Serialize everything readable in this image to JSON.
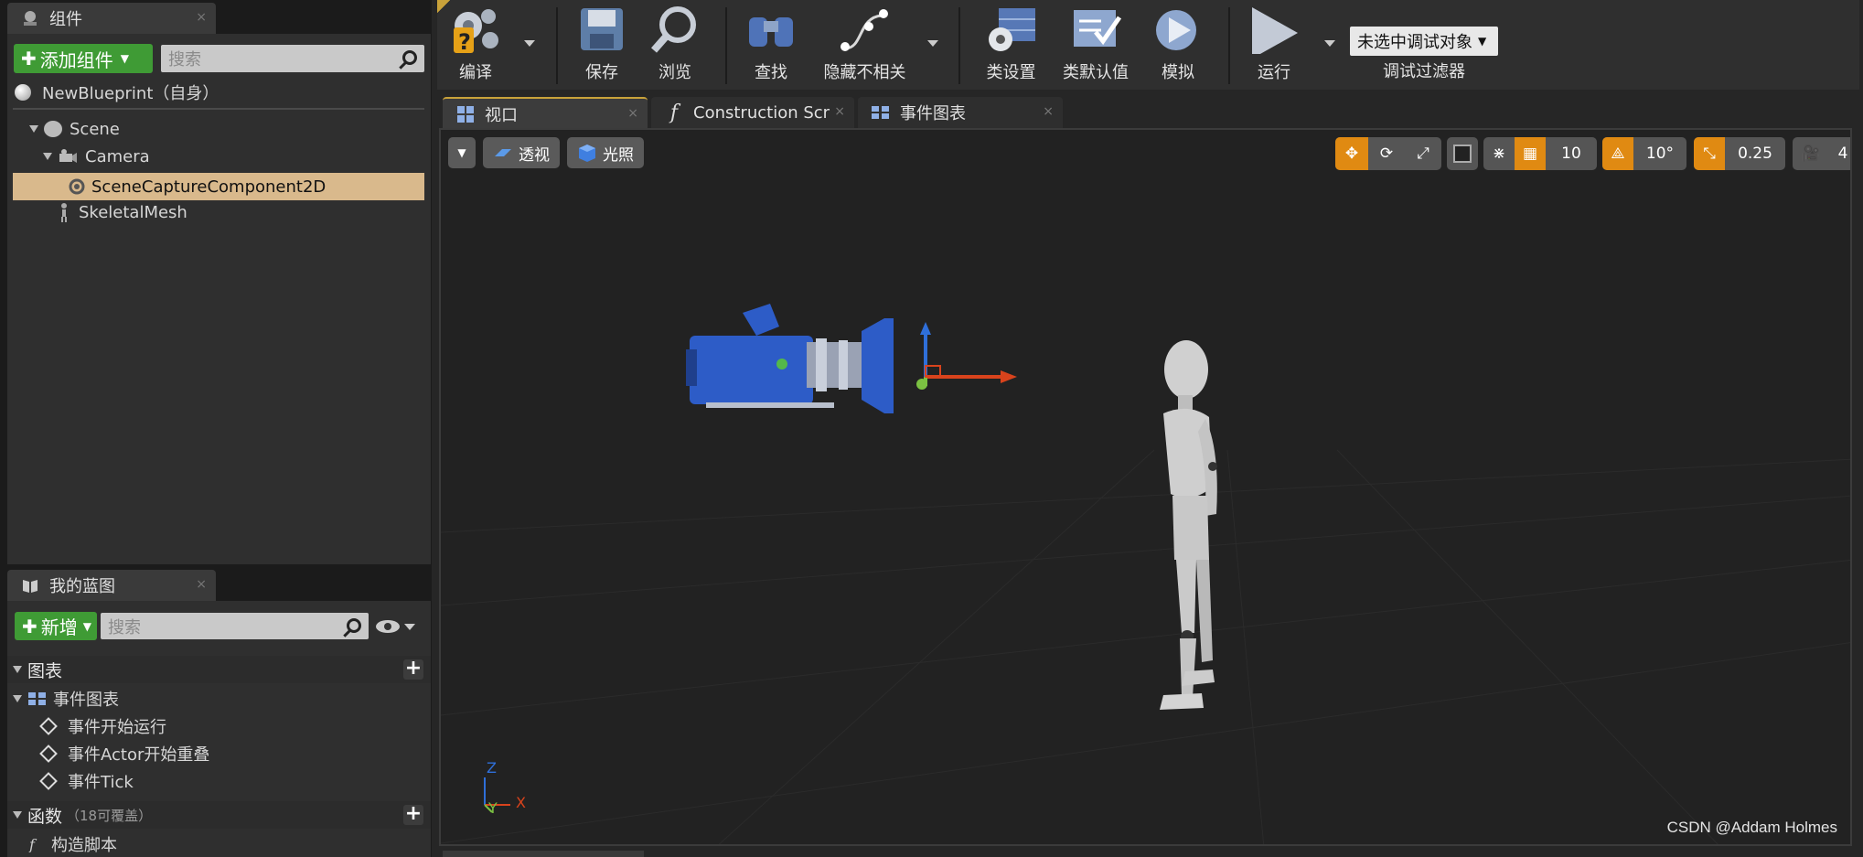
{
  "components_panel": {
    "tab_label": "组件",
    "tab_close": "×",
    "add_component_label": "添加组件",
    "search_placeholder": "搜索",
    "root_item": "NewBlueprint（自身）",
    "tree": [
      {
        "label": "Scene"
      },
      {
        "label": "Camera"
      },
      {
        "label": "SceneCaptureComponent2D",
        "selected": true
      },
      {
        "label": "SkeletalMesh"
      }
    ]
  },
  "my_blueprint_panel": {
    "tab_label": "我的蓝图",
    "tab_close": "×",
    "new_label": "新增",
    "search_placeholder": "搜索",
    "graphs_label": "图表",
    "event_graph_label": "事件图表",
    "events": [
      "事件开始运行",
      "事件Actor开始重叠",
      "事件Tick"
    ],
    "functions_label": "函数",
    "functions_note": "（18可覆盖）",
    "construction_script_label": "构造脚本"
  },
  "toolbar": {
    "compile": "编译",
    "save": "保存",
    "browse": "浏览",
    "find": "查找",
    "hide_unrelated": "隐藏不相关",
    "class_settings": "类设置",
    "class_defaults": "类默认值",
    "simulate": "模拟",
    "play": "运行",
    "debug_object": "未选中调试对象",
    "debug_filter": "调试过滤器"
  },
  "editor_tabs": [
    {
      "label": "视口",
      "active": true
    },
    {
      "label": "Construction Script",
      "active": false
    },
    {
      "label": "事件图表",
      "active": false
    }
  ],
  "viewport": {
    "perspective_label": "透视",
    "lighting_label": "光照",
    "grid_snap_value": "10",
    "rotation_snap_value": "10°",
    "scale_snap_value": "0.25",
    "camera_speed_value": "4",
    "axis_labels": {
      "z": "Z",
      "y": "Y",
      "x": "X"
    }
  },
  "watermark": "CSDN @Addam Holmes",
  "colors": {
    "accent_orange": "#e08a12",
    "add_green": "#3f9b35",
    "selection": "#d9b98c"
  }
}
